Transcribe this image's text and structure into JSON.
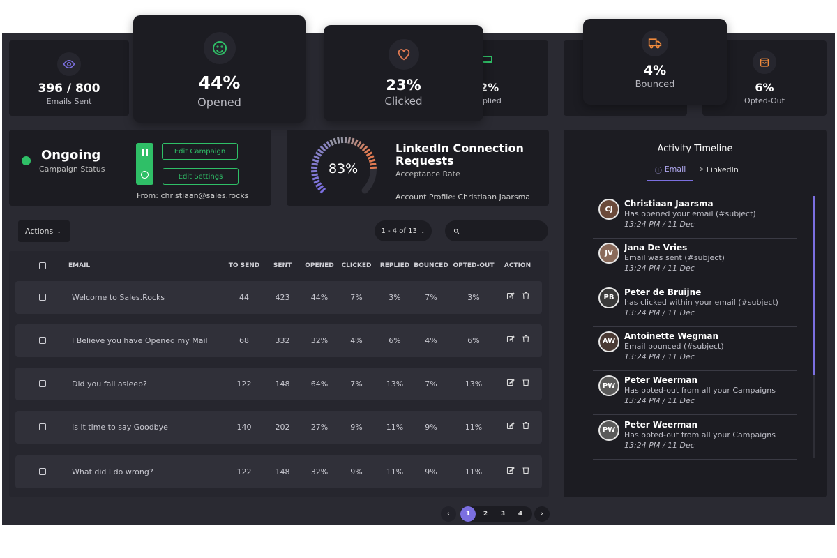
{
  "colors": {
    "accent": "#7b6fe0",
    "green": "#2fbf67",
    "orange": "#e07a52",
    "panel": "#2a2a32",
    "card": "#1c1c22"
  },
  "stats": [
    {
      "value": "396 / 800",
      "label": "Emails Sent",
      "icon": "eye-icon",
      "color": "#7b6fe0"
    },
    {
      "value": "44%",
      "label": "Opened",
      "icon": "smiley-icon",
      "color": "#2fbf67"
    },
    {
      "value": "23%",
      "label": "Clicked",
      "icon": "heart-icon",
      "color": "#e07a52"
    },
    {
      "value": "2%",
      "label": "plied",
      "icon": "reply-icon",
      "color": "#2fbf67"
    },
    {
      "value": "4%",
      "label": "Bounced",
      "icon": "truck-icon",
      "color": "#f08a3c"
    },
    {
      "value": "6%",
      "label": "Opted-Out",
      "icon": "bag-icon",
      "color": "#f08a3c"
    }
  ],
  "campaign": {
    "status": "Ongoing",
    "status_label": "Campaign Status",
    "edit_campaign": "Edit Campaign",
    "edit_settings": "Edit Settings",
    "from": "From: christiaan@sales.rocks"
  },
  "linkedin": {
    "title": "LinkedIn Connection Requests",
    "subtitle": "Acceptance Rate",
    "rate": 83,
    "rate_label": "83%",
    "profile": "Account Profile: Christiaan Jaarsma"
  },
  "toolbar": {
    "actions": "Actions",
    "pager": "1 - 4 of 13",
    "search_placeholder": ""
  },
  "table": {
    "headers": [
      "EMAIL",
      "TO SEND",
      "SENT",
      "OPENED",
      "CLICKED",
      "REPLIED",
      "BOUNCED",
      "OPTED-OUT",
      "ACTION"
    ],
    "rows": [
      [
        "Welcome to Sales.Rocks",
        "44",
        "423",
        "44%",
        "7%",
        "3%",
        "7%",
        "3%"
      ],
      [
        "I Believe you have Opened my Mail",
        "68",
        "332",
        "32%",
        "4%",
        "6%",
        "4%",
        "6%"
      ],
      [
        "Did you fall asleep?",
        "122",
        "148",
        "64%",
        "7%",
        "13%",
        "7%",
        "13%"
      ],
      [
        "Is it time to say Goodbye",
        "140",
        "202",
        "27%",
        "9%",
        "11%",
        "9%",
        "11%"
      ],
      [
        "What did I do wrong?",
        "122",
        "148",
        "32%",
        "9%",
        "11%",
        "9%",
        "11%"
      ]
    ]
  },
  "pagination": {
    "pages": [
      "1",
      "2",
      "3",
      "4"
    ],
    "current": "1"
  },
  "timeline": {
    "title": "Activity Timeline",
    "tabs": [
      {
        "label": "Email",
        "active": true
      },
      {
        "label": "LinkedIn",
        "active": false
      }
    ],
    "items": [
      {
        "name": "Christiaan Jaarsma",
        "desc": "Has opened your email (#subject)",
        "time": "13:24 PM / 11 Dec",
        "initials": "CJ"
      },
      {
        "name": "Jana De Vries",
        "desc": "Email was sent (#subject)",
        "time": "13:24 PM / 11 Dec",
        "initials": "JV"
      },
      {
        "name": "Peter de Bruijne",
        "desc": "has clicked within your email (#subject)",
        "time": "13:24 PM / 11 Dec",
        "initials": "PB"
      },
      {
        "name": "Antoinette Wegman",
        "desc": "Email bounced (#subject)",
        "time": "13:24 PM / 11 Dec",
        "initials": "AW"
      },
      {
        "name": "Peter Weerman",
        "desc": "Has opted-out from all your Campaigns",
        "time": "13:24 PM / 11 Dec",
        "initials": "PW"
      },
      {
        "name": "Peter Weerman",
        "desc": "Has opted-out from all your Campaigns",
        "time": "13:24 PM / 11 Dec",
        "initials": "PW"
      }
    ]
  }
}
